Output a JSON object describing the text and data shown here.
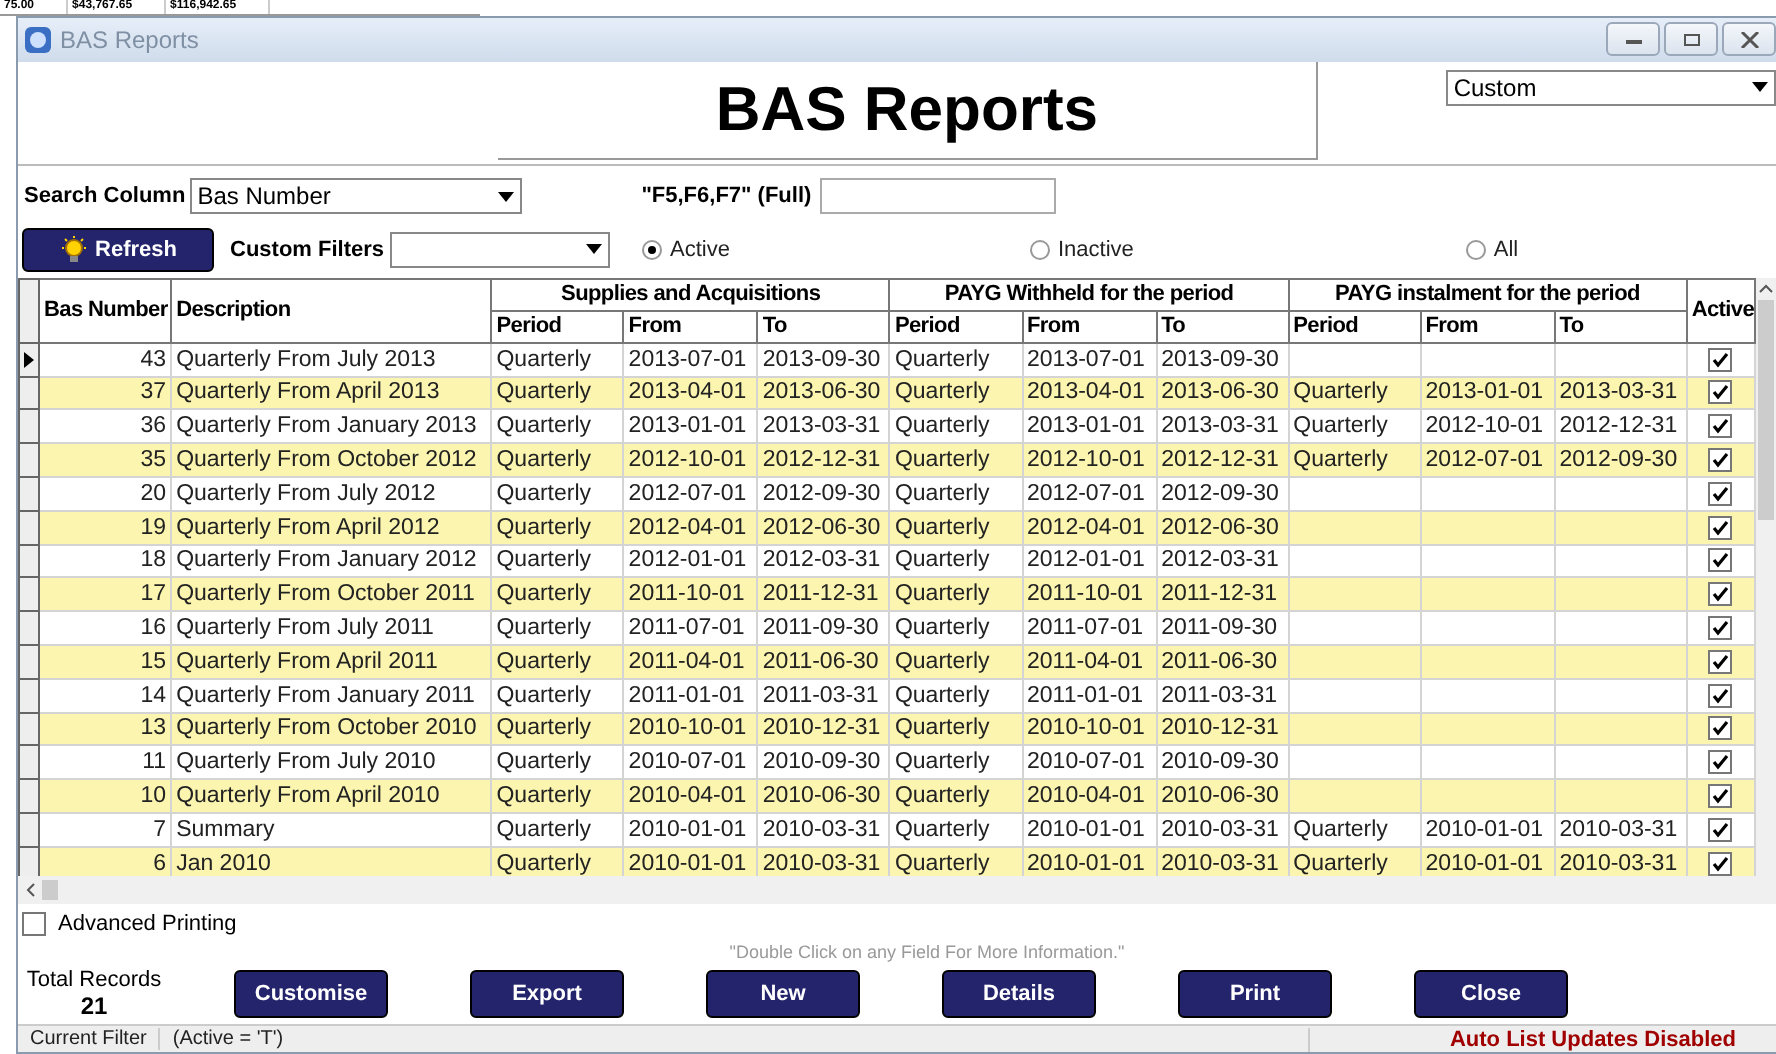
{
  "background_window": {
    "cells": [
      "75.00",
      "$43,767.65",
      "$116,942.65"
    ]
  },
  "window": {
    "title": "BAS Reports"
  },
  "header": {
    "title": "BAS Reports",
    "view_select": "Custom"
  },
  "search": {
    "label": "Search Column",
    "column": "Bas Number",
    "shortcut_label": "\"F5,F6,F7\" (Full)"
  },
  "filters": {
    "refresh": "Refresh",
    "custom_filters_label": "Custom Filters",
    "radios": [
      {
        "label": "Active",
        "selected": true
      },
      {
        "label": "Inactive",
        "selected": false
      },
      {
        "label": "All",
        "selected": false
      }
    ]
  },
  "table": {
    "columns": [
      "Bas Number",
      "Description"
    ],
    "groups": [
      {
        "title": "Supplies and Acquisitions",
        "columns": [
          "Period",
          "From",
          "To"
        ]
      },
      {
        "title": "PAYG Withheld for the period",
        "columns": [
          "Period",
          "From",
          "To"
        ]
      },
      {
        "title": "PAYG instalment for the period",
        "columns": [
          "Period",
          "From",
          "To"
        ]
      }
    ],
    "active_column": "Active",
    "rows": [
      {
        "selected": true,
        "bas_number": "43",
        "description": "Quarterly From July 2013",
        "groups": [
          [
            "Quarterly",
            "2013-07-01",
            "2013-09-30"
          ],
          [
            "Quarterly",
            "2013-07-01",
            "2013-09-30"
          ]
        ],
        "active": true
      },
      {
        "selected": false,
        "bas_number": "37",
        "description": "Quarterly From April 2013",
        "groups": [
          [
            "Quarterly",
            "2013-04-01",
            "2013-06-30"
          ],
          [
            "Quarterly",
            "2013-04-01",
            "2013-06-30"
          ],
          [
            "Quarterly",
            "2013-01-01",
            "2013-03-31"
          ]
        ],
        "active": true
      },
      {
        "selected": false,
        "bas_number": "36",
        "description": "Quarterly From January 2013",
        "groups": [
          [
            "Quarterly",
            "2013-01-01",
            "2013-03-31"
          ],
          [
            "Quarterly",
            "2013-01-01",
            "2013-03-31"
          ],
          [
            "Quarterly",
            "2012-10-01",
            "2012-12-31"
          ]
        ],
        "active": true
      },
      {
        "selected": false,
        "bas_number": "35",
        "description": "Quarterly From October 2012",
        "groups": [
          [
            "Quarterly",
            "2012-10-01",
            "2012-12-31"
          ],
          [
            "Quarterly",
            "2012-10-01",
            "2012-12-31"
          ],
          [
            "Quarterly",
            "2012-07-01",
            "2012-09-30"
          ]
        ],
        "active": true
      },
      {
        "selected": false,
        "bas_number": "20",
        "description": "Quarterly From July 2012",
        "groups": [
          [
            "Quarterly",
            "2012-07-01",
            "2012-09-30"
          ],
          [
            "Quarterly",
            "2012-07-01",
            "2012-09-30"
          ]
        ],
        "active": true
      },
      {
        "selected": false,
        "bas_number": "19",
        "description": "Quarterly From April 2012",
        "groups": [
          [
            "Quarterly",
            "2012-04-01",
            "2012-06-30"
          ],
          [
            "Quarterly",
            "2012-04-01",
            "2012-06-30"
          ]
        ],
        "active": true
      },
      {
        "selected": false,
        "bas_number": "18",
        "description": "Quarterly From January 2012",
        "groups": [
          [
            "Quarterly",
            "2012-01-01",
            "2012-03-31"
          ],
          [
            "Quarterly",
            "2012-01-01",
            "2012-03-31"
          ]
        ],
        "active": true
      },
      {
        "selected": false,
        "bas_number": "17",
        "description": "Quarterly From October 2011",
        "groups": [
          [
            "Quarterly",
            "2011-10-01",
            "2011-12-31"
          ],
          [
            "Quarterly",
            "2011-10-01",
            "2011-12-31"
          ]
        ],
        "active": true
      },
      {
        "selected": false,
        "bas_number": "16",
        "description": "Quarterly From July 2011",
        "groups": [
          [
            "Quarterly",
            "2011-07-01",
            "2011-09-30"
          ],
          [
            "Quarterly",
            "2011-07-01",
            "2011-09-30"
          ]
        ],
        "active": true
      },
      {
        "selected": false,
        "bas_number": "15",
        "description": "Quarterly From April 2011",
        "groups": [
          [
            "Quarterly",
            "2011-04-01",
            "2011-06-30"
          ],
          [
            "Quarterly",
            "2011-04-01",
            "2011-06-30"
          ]
        ],
        "active": true
      },
      {
        "selected": false,
        "bas_number": "14",
        "description": "Quarterly From January 2011",
        "groups": [
          [
            "Quarterly",
            "2011-01-01",
            "2011-03-31"
          ],
          [
            "Quarterly",
            "2011-01-01",
            "2011-03-31"
          ]
        ],
        "active": true
      },
      {
        "selected": false,
        "bas_number": "13",
        "description": "Quarterly From October 2010",
        "groups": [
          [
            "Quarterly",
            "2010-10-01",
            "2010-12-31"
          ],
          [
            "Quarterly",
            "2010-10-01",
            "2010-12-31"
          ]
        ],
        "active": true
      },
      {
        "selected": false,
        "bas_number": "11",
        "description": "Quarterly From July 2010",
        "groups": [
          [
            "Quarterly",
            "2010-07-01",
            "2010-09-30"
          ],
          [
            "Quarterly",
            "2010-07-01",
            "2010-09-30"
          ]
        ],
        "active": true
      },
      {
        "selected": false,
        "bas_number": "10",
        "description": "Quarterly From April 2010",
        "groups": [
          [
            "Quarterly",
            "2010-04-01",
            "2010-06-30"
          ],
          [
            "Quarterly",
            "2010-04-01",
            "2010-06-30"
          ]
        ],
        "active": true
      },
      {
        "selected": false,
        "bas_number": "7",
        "description": "Summary",
        "groups": [
          [
            "Quarterly",
            "2010-01-01",
            "2010-03-31"
          ],
          [
            "Quarterly",
            "2010-01-01",
            "2010-03-31"
          ],
          [
            "Quarterly",
            "2010-01-01",
            "2010-03-31"
          ]
        ],
        "active": true
      },
      {
        "selected": false,
        "bas_number": "6",
        "description": "Jan 2010",
        "groups": [
          [
            "Quarterly",
            "2010-01-01",
            "2010-03-31"
          ],
          [
            "Quarterly",
            "2010-01-01",
            "2010-03-31"
          ],
          [
            "Quarterly",
            "2010-01-01",
            "2010-03-31"
          ]
        ],
        "active": true
      }
    ]
  },
  "advanced_printing": {
    "label": "Advanced Printing",
    "checked": false
  },
  "hint": "\"Double Click on any Field For More Information.\"",
  "total_records": {
    "label": "Total Records",
    "value": "21"
  },
  "buttons": [
    "Customise",
    "Export",
    "New",
    "Details",
    "Print",
    "Close"
  ],
  "status_bar": {
    "label": "Current Filter",
    "filter": "(Active = 'T')",
    "notice": "Auto List Updates Disabled"
  }
}
